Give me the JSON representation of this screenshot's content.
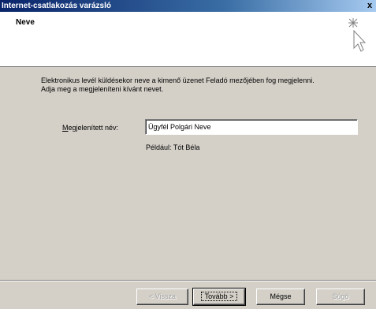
{
  "window": {
    "title": "Internet-csatlakozás varázsló",
    "close_glyph": "x"
  },
  "header": {
    "title": "Neve",
    "icon": "wizard-sparkle-cursor-icon"
  },
  "body": {
    "description_line1": "Elektronikus levél küldésekor neve a kimenő üzenet Feladó mezőjében fog megjelenni.",
    "description_line2": "Adja meg a megjeleníteni kívánt nevet.",
    "field_label_accel": "M",
    "field_label_rest": "egjelenített név:",
    "field_value": "Ügyfél Polgári Neve",
    "example": "Például: Tót Béla"
  },
  "buttons": {
    "back": "< Vissza",
    "next": "Tovább >",
    "cancel": "Mégse",
    "help": "Súgó"
  }
}
